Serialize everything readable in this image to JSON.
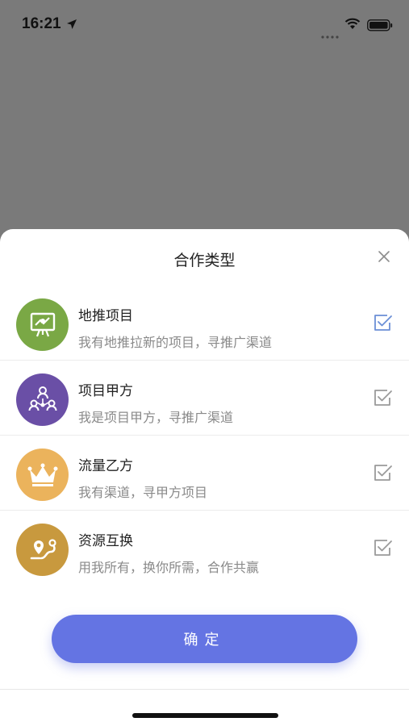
{
  "status_bar": {
    "time": "16:21",
    "icons": [
      "location-arrow-icon",
      "signal-dots-icon",
      "wifi-icon",
      "battery-icon"
    ]
  },
  "sheet": {
    "title": "合作类型",
    "close_icon": "close-icon",
    "options": [
      {
        "title": "地推项目",
        "description": "我有地推拉新的项目，寻推广渠道",
        "icon": "billboard-icon",
        "icon_bg": "#7aa845",
        "checked": true,
        "check_color": "#6b8fd6"
      },
      {
        "title": "项目甲方",
        "description": "我是项目甲方，寻推广渠道",
        "icon": "team-network-icon",
        "icon_bg": "#6a4fa6",
        "checked": true,
        "check_color": "#9a9a9a"
      },
      {
        "title": "流量乙方",
        "description": "我有渠道，寻甲方项目",
        "icon": "crown-icon",
        "icon_bg": "#ebb35c",
        "checked": true,
        "check_color": "#9a9a9a"
      },
      {
        "title": "资源互换",
        "description": "用我所有，换你所需，合作共赢",
        "icon": "route-pin-icon",
        "icon_bg": "#c8993e",
        "checked": true,
        "check_color": "#9a9a9a"
      }
    ],
    "confirm_label": "确定",
    "confirm_color": "#6474e3"
  }
}
